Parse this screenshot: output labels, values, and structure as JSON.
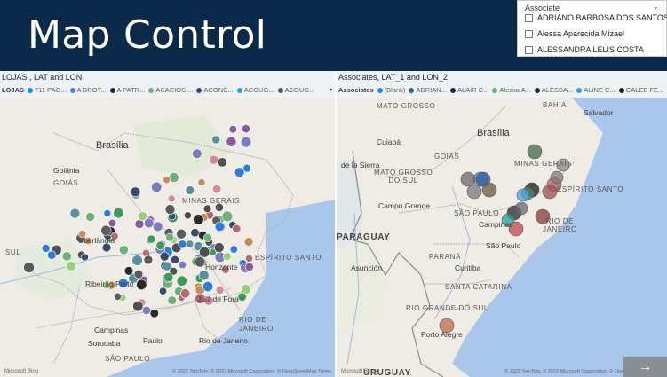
{
  "header": {
    "title": "Map Control",
    "bg_color": "#0b2a4a"
  },
  "slicer": {
    "title": "Associate",
    "items": [
      "ADRIANO BARBOSA DOS SANTOS",
      "Alessa Aparecida Mizael",
      "ALESSANDRA LELIS COSTA"
    ]
  },
  "left_map": {
    "title": "LOJAS , LAT and LON",
    "legend_title": "LOJAS",
    "legend": [
      {
        "label": "711 PAG...",
        "color": "#118dff"
      },
      {
        "label": "A BROT...",
        "color": "#4f7fdc"
      },
      {
        "label": "A PATR...",
        "color": "#1b2b4a"
      },
      {
        "label": "ACACIOS ...",
        "color": "#6fb07a"
      },
      {
        "label": "ACONC...",
        "color": "#3b3f9b"
      },
      {
        "label": "ACOUG...",
        "color": "#2d9cdb"
      },
      {
        "label": "ACOUG...",
        "color": "#4e5a6a"
      }
    ],
    "labels": {
      "brasilia": "Brasília",
      "goias": "GOIÁS",
      "goiania": "Goiânia",
      "minas": "MINAS GERAIS",
      "uberlandia": "Uberlândia",
      "sul": "SUL",
      "espirito": "ESPÍRITO SANTO",
      "ribeirao": "Ribeirão Preto",
      "juiz": "Juiz de Fora",
      "rio_state": "RIO DE JANEIRO",
      "campinas": "Campinas",
      "sorocaba": "Sorocaba",
      "rio": "Rio de Janeiro",
      "saopaulo": "SÃO PAULO",
      "horizonte": "Horizonte",
      "paulo_small": "Paulo"
    },
    "footer_bing": "Microsoft Bing",
    "footer_copy": "© 2023 TomTom, © 2023 Microsoft Corporation, © OpenStreetMap  Terms"
  },
  "right_map": {
    "title": "Associates, LAT_1 and LON_2",
    "legend_title": "Associates",
    "legend": [
      {
        "label": "(Blank)",
        "color": "#118dff"
      },
      {
        "label": "ADRIAN...",
        "color": "#3b5ba9"
      },
      {
        "label": "ALAIR C...",
        "color": "#1b2b4a"
      },
      {
        "label": "Alessa A...",
        "color": "#5fb46a"
      },
      {
        "label": "ALESSA...",
        "color": "#2a2a2a"
      },
      {
        "label": "ALINE C...",
        "color": "#2d9cdb"
      },
      {
        "label": "CALEB FE...",
        "color": "#222222"
      }
    ],
    "labels": {
      "matogrosso": "MATO GROSSO",
      "bahia": "BAHIA",
      "salvador": "Salvador",
      "cuiaba": "Cuiabá",
      "brasilia": "Brasília",
      "dasierra": "de la Sierra",
      "goias": "GOIÁS",
      "msul": "MATO GROSSO\nDO SUL",
      "minas": "MINAS GERAIS",
      "campogrande": "Campo Grande",
      "espirito": "ESPÍRITO SANTO",
      "saopaulo_state": "SÃO PAULO",
      "rj": "RIO DE\nJANEIRO",
      "campinas": "Campinas",
      "saopaulo": "São Paulo",
      "paraguay": "PARAGUAY",
      "parana": "PARANÁ",
      "asuncion": "Asunción",
      "curitiba": "Curitiba",
      "sc": "SANTA CATARINA",
      "rgs": "RIO GRANDE DO SUL",
      "portoalegre": "Porto Alegre",
      "uruguay": "URUGUAY"
    },
    "footer_bing": "Microsoft Bing",
    "footer_copy": "© 2023 TomTom, © 2023 Microsoft Corporation, © OpenStreetMap  Terms"
  },
  "nav": {
    "icon": "arrow-right-icon",
    "glyph": "→"
  }
}
